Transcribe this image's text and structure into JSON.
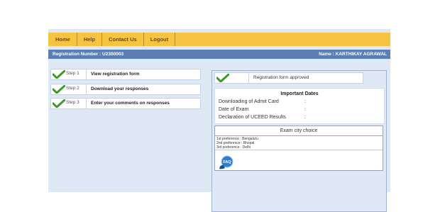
{
  "menu": {
    "home": "Home",
    "help": "Help",
    "contact": "Contact Us",
    "logout": "Logout"
  },
  "info": {
    "registration": "Registration Number : U2300003",
    "name": "Name : KARTHIKAY AGRAWAL"
  },
  "steps": [
    {
      "num": "Step 1",
      "label": "View registration form"
    },
    {
      "num": "Step 2",
      "label": "Download your responses"
    },
    {
      "num": "Step 3",
      "label": "Enter your comments on responses"
    }
  ],
  "status": {
    "label": "Registration form approved"
  },
  "important_dates": {
    "title": "Important Dates",
    "rows": [
      {
        "label": "Downloading of Admit Card",
        "sep": ":"
      },
      {
        "label": "Date of Exam",
        "sep": ":"
      },
      {
        "label": "Declaration of UCEED Results",
        "sep": ":"
      }
    ]
  },
  "exam_city": {
    "title": "Exam city choice",
    "prefs": [
      "1st preference : Bengaluru",
      "2nd preference : Bhopal",
      "3rd preference : Delhi"
    ]
  },
  "faq": {
    "label": "FAQ"
  },
  "colors": {
    "menubar": "#f6c441",
    "infobar": "#5c7fb3",
    "frame": "#dfe9f6",
    "check": "#3a9a2a"
  }
}
